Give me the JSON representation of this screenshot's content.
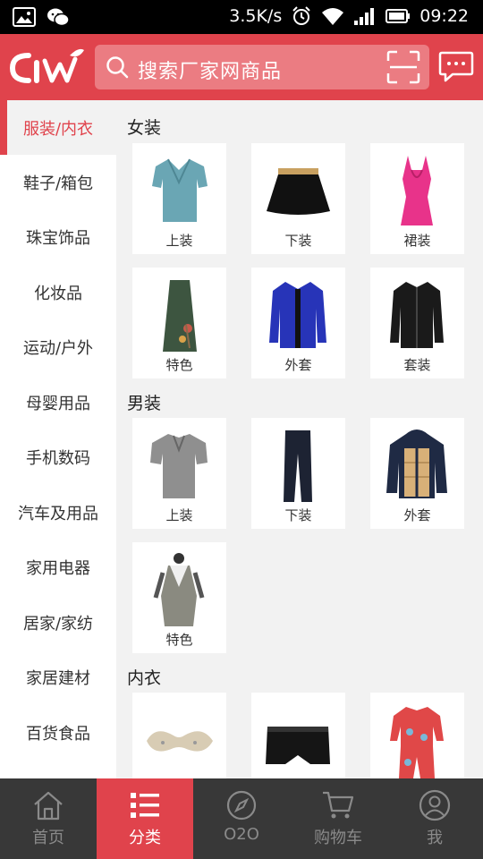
{
  "status_bar": {
    "speed": "3.5K/s",
    "time": "09:22"
  },
  "header": {
    "search_placeholder": "搜索厂家网商品"
  },
  "sidebar": {
    "items": [
      {
        "label": "服装/内衣"
      },
      {
        "label": "鞋子/箱包"
      },
      {
        "label": "珠宝饰品"
      },
      {
        "label": "化妆品"
      },
      {
        "label": "运动/户外"
      },
      {
        "label": "母婴用品"
      },
      {
        "label": "手机数码"
      },
      {
        "label": "汽车及用品"
      },
      {
        "label": "家用电器"
      },
      {
        "label": "居家/家纺"
      },
      {
        "label": "家居建材"
      },
      {
        "label": "百货食品"
      }
    ],
    "active_index": 0
  },
  "sections": [
    {
      "title": "女装",
      "items": [
        {
          "label": "上装",
          "icon": "blouse-icon"
        },
        {
          "label": "下装",
          "icon": "skirt-icon"
        },
        {
          "label": "裙装",
          "icon": "dress-icon"
        },
        {
          "label": "特色",
          "icon": "long-skirt-icon"
        },
        {
          "label": "外套",
          "icon": "coat-icon"
        },
        {
          "label": "套装",
          "icon": "suit-icon"
        }
      ]
    },
    {
      "title": "男装",
      "items": [
        {
          "label": "上装",
          "icon": "polo-shirt-icon"
        },
        {
          "label": "下装",
          "icon": "trousers-icon"
        },
        {
          "label": "外套",
          "icon": "down-jacket-icon"
        },
        {
          "label": "特色",
          "icon": "robe-icon"
        }
      ]
    },
    {
      "title": "内衣",
      "items": [
        {
          "label": "",
          "icon": "bra-icon"
        },
        {
          "label": "",
          "icon": "boxer-briefs-icon"
        },
        {
          "label": "",
          "icon": "pajamas-icon"
        }
      ]
    }
  ],
  "bottom_nav": {
    "items": [
      {
        "label": "首页",
        "icon": "home-icon"
      },
      {
        "label": "分类",
        "icon": "category-list-icon"
      },
      {
        "label": "O2O",
        "icon": "compass-icon"
      },
      {
        "label": "购物车",
        "icon": "cart-icon"
      },
      {
        "label": "我",
        "icon": "user-icon"
      }
    ],
    "active_index": 1
  },
  "colors": {
    "brand": "#e0434c",
    "nav_bg": "#383838",
    "page_bg": "#f2f2f2"
  }
}
